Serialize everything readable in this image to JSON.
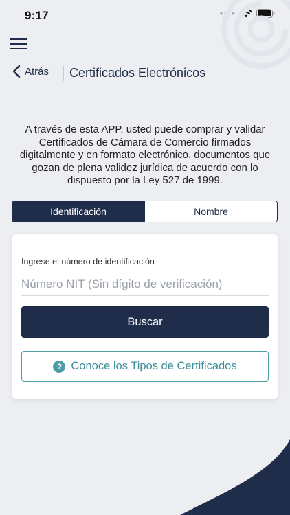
{
  "status": {
    "time": "9:17"
  },
  "nav": {
    "back_label": "Atrás",
    "title": "Certificados Electrónicos"
  },
  "intro_text": "A través de esta APP, usted puede comprar y validar Certificados de Cámara de Comercio firmados digitalmente y en formato electrónico, documentos que gozan de plena validez jurídica de acuerdo con lo dispuesto por la Ley 527 de 1999.",
  "tabs": [
    {
      "label": "Identificación",
      "active": true
    },
    {
      "label": "Nombre",
      "active": false
    }
  ],
  "form": {
    "label": "Ingrese el número de identificación",
    "placeholder": "Número NIT (Sin dígito de verificación)",
    "value": ""
  },
  "buttons": {
    "search": "Buscar",
    "types": "Conoce los Tipos de Certificados",
    "types_icon": "?"
  },
  "colors": {
    "primary": "#1f2d4a",
    "accent": "#4d9da6",
    "background": "#eceef1"
  }
}
